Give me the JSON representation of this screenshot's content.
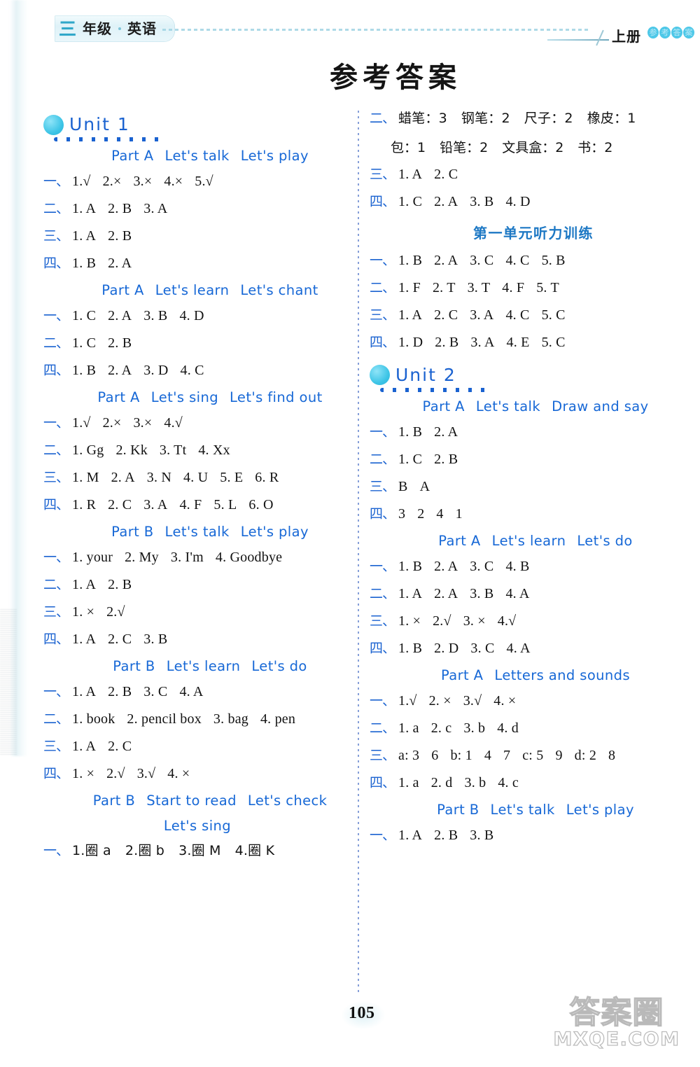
{
  "header": {
    "grade_number": "三",
    "grade_word": "年级",
    "subject": "英语",
    "volume": "上册",
    "badge_text": "参考答案"
  },
  "title": "参考答案",
  "footer": {
    "page_number": "105",
    "watermark_cjk": "答案圈",
    "watermark_url": "MXQE.COM"
  },
  "left_column": [
    {
      "kind": "unit",
      "label": "Unit 1"
    },
    {
      "kind": "part",
      "segments": [
        "Part A",
        "Let's talk",
        "Let's play"
      ]
    },
    {
      "kind": "answer",
      "num": "一、",
      "items": [
        "1.√",
        "2.×",
        "3.×",
        "4.×",
        "5.√"
      ]
    },
    {
      "kind": "answer",
      "num": "二、",
      "items": [
        "1. A",
        "2. B",
        "3. A"
      ]
    },
    {
      "kind": "answer",
      "num": "三、",
      "items": [
        "1. A",
        "2. B"
      ]
    },
    {
      "kind": "answer",
      "num": "四、",
      "items": [
        "1. B",
        "2. A"
      ]
    },
    {
      "kind": "part",
      "segments": [
        "Part A",
        "Let's learn",
        "Let's chant"
      ]
    },
    {
      "kind": "answer",
      "num": "一、",
      "items": [
        "1. C",
        "2. A",
        "3. B",
        "4. D"
      ]
    },
    {
      "kind": "answer",
      "num": "二、",
      "items": [
        "1. C",
        "2. B"
      ]
    },
    {
      "kind": "answer",
      "num": "四、",
      "items": [
        "1. B",
        "2. A",
        "3. D",
        "4. C"
      ]
    },
    {
      "kind": "part",
      "segments": [
        "Part A",
        "Let's sing",
        "Let's find out"
      ]
    },
    {
      "kind": "answer",
      "num": "一、",
      "items": [
        "1.√",
        "2.×",
        "3.×",
        "4.√"
      ]
    },
    {
      "kind": "answer",
      "num": "二、",
      "items": [
        "1. Gg",
        "2. Kk",
        "3. Tt",
        "4. Xx"
      ]
    },
    {
      "kind": "answer",
      "num": "三、",
      "items": [
        "1. M",
        "2. A",
        "3. N",
        "4. U",
        "5. E",
        "6. R"
      ]
    },
    {
      "kind": "answer",
      "num": "四、",
      "items": [
        "1. R",
        "2. C",
        "3. A",
        "4. F",
        "5. L",
        "6. O"
      ]
    },
    {
      "kind": "part",
      "segments": [
        "Part B",
        "Let's talk",
        "Let's play"
      ]
    },
    {
      "kind": "answer",
      "num": "一、",
      "items": [
        "1. your",
        "2. My",
        "3. I'm",
        "4. Goodbye"
      ]
    },
    {
      "kind": "answer",
      "num": "二、",
      "items": [
        "1. A",
        "2. B"
      ]
    },
    {
      "kind": "answer",
      "num": "三、",
      "items": [
        "1. ×",
        "2.√"
      ]
    },
    {
      "kind": "answer",
      "num": "四、",
      "items": [
        "1. A",
        "2. C",
        "3. B"
      ]
    },
    {
      "kind": "part",
      "segments": [
        "Part B",
        "Let's learn",
        "Let's do"
      ]
    },
    {
      "kind": "answer",
      "num": "一、",
      "items": [
        "1. A",
        "2. B",
        "3. C",
        "4. A"
      ]
    },
    {
      "kind": "answer",
      "num": "二、",
      "items": [
        "1. book",
        "2. pencil box",
        "3. bag",
        "4. pen"
      ]
    },
    {
      "kind": "answer",
      "num": "三、",
      "items": [
        "1. A",
        "2. C"
      ]
    },
    {
      "kind": "answer",
      "num": "四、",
      "items": [
        "1. ×",
        "2.√",
        "3.√",
        "4. ×"
      ]
    },
    {
      "kind": "part",
      "segments": [
        "Part B",
        "Start to read",
        "Let's check"
      ]
    },
    {
      "kind": "part-center",
      "segments": [
        "Let's sing"
      ]
    },
    {
      "kind": "answer",
      "num": "一、",
      "cjk": true,
      "items": [
        "1.圈 a",
        "2.圈 b",
        "3.圈 M",
        "4.圈 K"
      ]
    }
  ],
  "right_column": [
    {
      "kind": "answer",
      "num": "二、",
      "cjk": true,
      "items": [
        "蜡笔：3",
        "钢笔：2",
        "尺子：2",
        "橡皮：1"
      ]
    },
    {
      "kind": "continuation",
      "cjk": true,
      "items": [
        "包：1",
        "铅笔：2",
        "文具盒：2",
        "书：2"
      ]
    },
    {
      "kind": "answer",
      "num": "三、",
      "items": [
        "1. A",
        "2. C"
      ]
    },
    {
      "kind": "answer",
      "num": "四、",
      "items": [
        "1. C",
        "2. A",
        "3. B",
        "4. D"
      ]
    },
    {
      "kind": "section",
      "label": "第一单元听力训练"
    },
    {
      "kind": "answer",
      "num": "一、",
      "items": [
        "1. B",
        "2. A",
        "3. C",
        "4. C",
        "5. B"
      ]
    },
    {
      "kind": "answer",
      "num": "二、",
      "items": [
        "1. F",
        "2. T",
        "3. T",
        "4. F",
        "5. T"
      ]
    },
    {
      "kind": "answer",
      "num": "三、",
      "items": [
        "1. A",
        "2. C",
        "3. A",
        "4. C",
        "5. C"
      ]
    },
    {
      "kind": "answer",
      "num": "四、",
      "items": [
        "1. D",
        "2. B",
        "3. A",
        "4. E",
        "5. C"
      ]
    },
    {
      "kind": "unit",
      "label": "Unit 2"
    },
    {
      "kind": "part",
      "segments": [
        "Part A",
        "Let's talk",
        "Draw and say"
      ]
    },
    {
      "kind": "answer",
      "num": "一、",
      "items": [
        "1. B",
        "2. A"
      ]
    },
    {
      "kind": "answer",
      "num": "二、",
      "items": [
        "1. C",
        "2. B"
      ]
    },
    {
      "kind": "answer",
      "num": "三、",
      "items": [
        "B",
        "A"
      ]
    },
    {
      "kind": "answer",
      "num": "四、",
      "items": [
        "3",
        "2",
        "4",
        "1"
      ]
    },
    {
      "kind": "part",
      "segments": [
        "Part A",
        "Let's learn",
        "Let's do"
      ]
    },
    {
      "kind": "answer",
      "num": "一、",
      "items": [
        "1. B",
        "2. A",
        "3. C",
        "4. B"
      ]
    },
    {
      "kind": "answer",
      "num": "二、",
      "items": [
        "1. A",
        "2. A",
        "3. B",
        "4. A"
      ]
    },
    {
      "kind": "answer",
      "num": "三、",
      "items": [
        "1. ×",
        "2.√",
        "3. ×",
        "4.√"
      ]
    },
    {
      "kind": "answer",
      "num": "四、",
      "items": [
        "1. B",
        "2. D",
        "3. C",
        "4. A"
      ]
    },
    {
      "kind": "part",
      "segments": [
        "Part A",
        "Letters and sounds"
      ]
    },
    {
      "kind": "answer",
      "num": "一、",
      "items": [
        "1.√",
        "2. ×",
        "3.√",
        "4. ×"
      ]
    },
    {
      "kind": "answer",
      "num": "二、",
      "items": [
        "1. a",
        "2. c",
        "3. b",
        "4. d"
      ]
    },
    {
      "kind": "answer",
      "num": "三、",
      "items": [
        "a: 3",
        "6",
        "b: 1",
        "4",
        "7",
        "c: 5",
        "9",
        "d: 2",
        "8"
      ]
    },
    {
      "kind": "answer",
      "num": "四、",
      "items": [
        "1. a",
        "2. d",
        "3. b",
        "4. c"
      ]
    },
    {
      "kind": "part",
      "segments": [
        "Part B",
        "Let's talk",
        "Let's play"
      ]
    },
    {
      "kind": "answer",
      "num": "一、",
      "items": [
        "1. A",
        "2. B",
        "3. B"
      ]
    }
  ]
}
